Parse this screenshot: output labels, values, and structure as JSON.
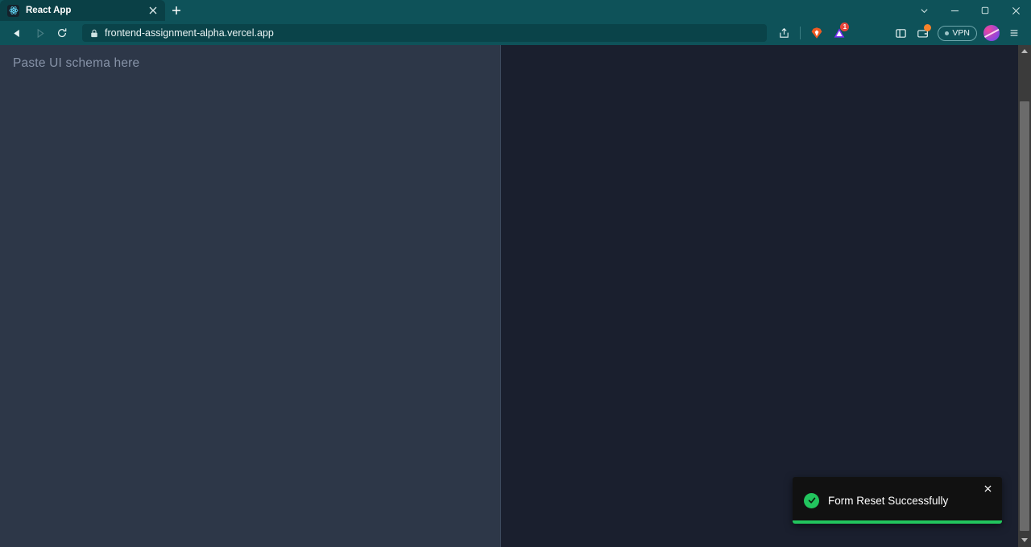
{
  "browser": {
    "tab": {
      "title": "React App",
      "favicon_icon": "react-logo-icon",
      "close_icon": "close-icon"
    },
    "new_tab_icon": "plus-icon",
    "window_controls": [
      {
        "name": "tab-search-button",
        "icon": "chevron-down-icon"
      },
      {
        "name": "minimize-button",
        "icon": "minimize-icon"
      },
      {
        "name": "maximize-button",
        "icon": "maximize-icon"
      },
      {
        "name": "close-window-button",
        "icon": "close-icon"
      }
    ],
    "nav": {
      "back_icon": "back-arrow-icon",
      "forward_icon": "forward-arrow-icon",
      "reload_icon": "reload-icon",
      "bookmark_icon": "bookmark-icon"
    },
    "url": "frontend-assignment-alpha.vercel.app",
    "url_lock_icon": "lock-icon",
    "toolbar_icons": [
      {
        "name": "share-button",
        "icon": "share-icon"
      },
      {
        "name": "brave-shields-button",
        "icon": "brave-lion-icon"
      },
      {
        "name": "extension-button",
        "icon": "triangle-extension-icon",
        "badge": "1"
      },
      {
        "name": "sidebar-button",
        "icon": "sidebar-panel-icon"
      },
      {
        "name": "wallet-button",
        "icon": "wallet-icon",
        "badge_dot": true
      },
      {
        "name": "vpn-button",
        "icon": "vpn-icon",
        "label": "VPN"
      },
      {
        "name": "profile-button",
        "icon": "avatar-icon"
      },
      {
        "name": "browser-menu-button",
        "icon": "hamburger-menu-icon"
      }
    ]
  },
  "page": {
    "editor": {
      "placeholder": "Paste UI schema here",
      "value": ""
    },
    "preview": {
      "content": ""
    },
    "toast": {
      "message": "Form Reset Successfully",
      "status_icon": "check-circle-icon",
      "close_icon": "close-icon",
      "accent_color": "#22c55e",
      "background_color": "#111111",
      "progress_percent": 100
    },
    "colors": {
      "editor_panel": "#2d3748",
      "preview_panel": "#1a1f2e",
      "browser_chrome": "#0e5259"
    }
  },
  "scrollbar": {
    "up_arrow_icon": "scroll-up-arrow-icon",
    "down_arrow_icon": "scroll-down-arrow-icon",
    "thumb_name": "scrollbar-thumb"
  }
}
